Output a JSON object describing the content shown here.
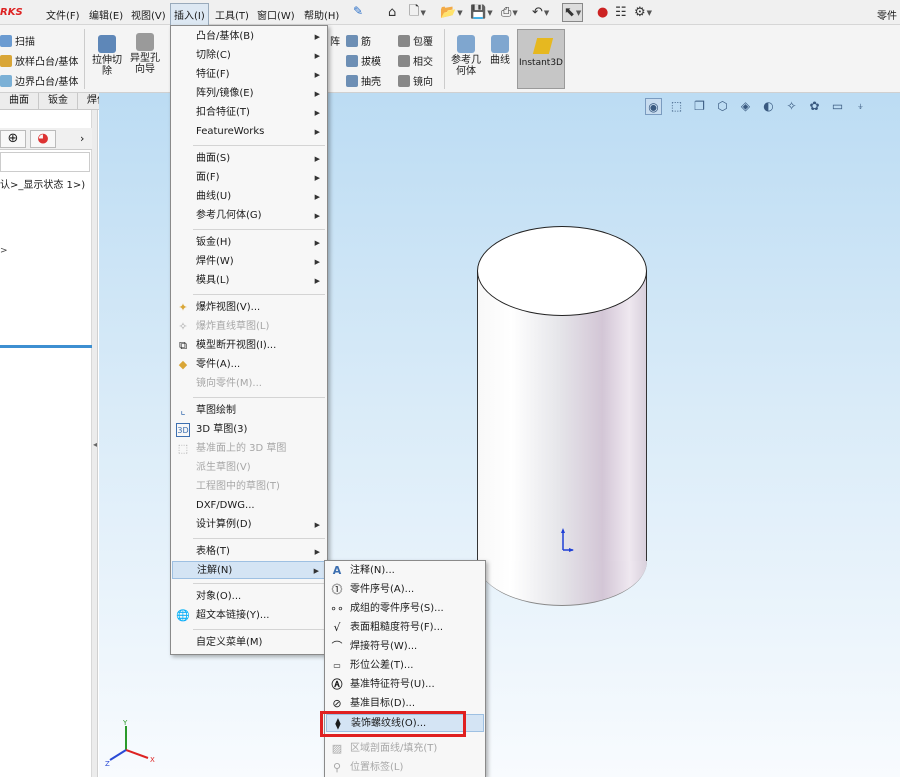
{
  "app": {
    "logo_text": "RKS",
    "part_label": "零件"
  },
  "menubar": {
    "items": [
      {
        "label": "文件(F)"
      },
      {
        "label": "编辑(E)"
      },
      {
        "label": "视图(V)"
      },
      {
        "label": "插入(I)"
      },
      {
        "label": "工具(T)"
      },
      {
        "label": "窗口(W)"
      },
      {
        "label": "帮助(H)"
      }
    ]
  },
  "command_manager": {
    "left_items": [
      "扫描",
      "放样凸台/基体",
      "边界凸台/基体"
    ],
    "extrude_cut": "拉伸切除",
    "hole_wizard": "异型孔向导",
    "rib": "筋",
    "wrap": "包覆",
    "draft": "拔模",
    "intersect": "相交",
    "shell": "抽壳",
    "mirror": "镜向",
    "pattern_partial": "阵",
    "ref_geometry": "参考几何体",
    "curves": "曲线",
    "instant3d": "Instant3D"
  },
  "tabs": [
    "曲面",
    "钣金",
    "焊件",
    "评估"
  ],
  "left_panel": {
    "tree_text": "认>_显示状态 1>)",
    "caret": ">"
  },
  "insert_menu": {
    "items": [
      {
        "label": "凸台/基体(B)",
        "sub": true
      },
      {
        "label": "切除(C)",
        "sub": true
      },
      {
        "label": "特征(F)",
        "sub": true
      },
      {
        "label": "阵列/镜像(E)",
        "sub": true
      },
      {
        "label": "扣合特征(T)",
        "sub": true
      },
      {
        "label": "FeatureWorks",
        "sub": true
      },
      {
        "label": "曲面(S)",
        "sub": true
      },
      {
        "label": "面(F)",
        "sub": true
      },
      {
        "label": "曲线(U)",
        "sub": true
      },
      {
        "label": "参考几何体(G)",
        "sub": true
      },
      {
        "label": "钣金(H)",
        "sub": true
      },
      {
        "label": "焊件(W)",
        "sub": true
      },
      {
        "label": "模具(L)",
        "sub": true
      },
      {
        "label": "爆炸视图(V)...",
        "sub": false
      },
      {
        "label": "爆炸直线草图(L)",
        "sub": false,
        "disabled": true
      },
      {
        "label": "模型断开视图(I)...",
        "sub": false
      },
      {
        "label": "零件(A)...",
        "sub": false
      },
      {
        "label": "镜向零件(M)...",
        "sub": false,
        "disabled": true
      },
      {
        "label": "草图绘制",
        "sub": false
      },
      {
        "label": "3D 草图(3)",
        "sub": false
      },
      {
        "label": "基准面上的 3D 草图",
        "sub": false,
        "disabled": true
      },
      {
        "label": "派生草图(V)",
        "sub": false,
        "disabled": true
      },
      {
        "label": "工程图中的草图(T)",
        "sub": false,
        "disabled": true
      },
      {
        "label": "DXF/DWG...",
        "sub": false
      },
      {
        "label": "设计算例(D)",
        "sub": true
      },
      {
        "label": "表格(T)",
        "sub": true
      },
      {
        "label": "注解(N)",
        "sub": true,
        "highlighted": true
      },
      {
        "label": "对象(O)...",
        "sub": false
      },
      {
        "label": "超文本链接(Y)...",
        "sub": false
      },
      {
        "label": "自定义菜单(M)",
        "sub": false
      }
    ]
  },
  "annotation_menu": {
    "items": [
      {
        "label": "注释(N)..."
      },
      {
        "label": "零件序号(A)..."
      },
      {
        "label": "成组的零件序号(S)..."
      },
      {
        "label": "表面粗糙度符号(F)..."
      },
      {
        "label": "焊接符号(W)..."
      },
      {
        "label": "形位公差(T)..."
      },
      {
        "label": "基准特征符号(U)..."
      },
      {
        "label": "基准目标(D)..."
      },
      {
        "label": "装饰螺纹线(O)...",
        "highlighted": true
      },
      {
        "label": "区域剖面线/填充(T)",
        "disabled": true
      },
      {
        "label": "位置标签(L)",
        "disabled": true
      }
    ]
  },
  "colors": {
    "accent": "#3d8fd1",
    "highlight_box": "#e02020",
    "logo": "#dd2222"
  }
}
